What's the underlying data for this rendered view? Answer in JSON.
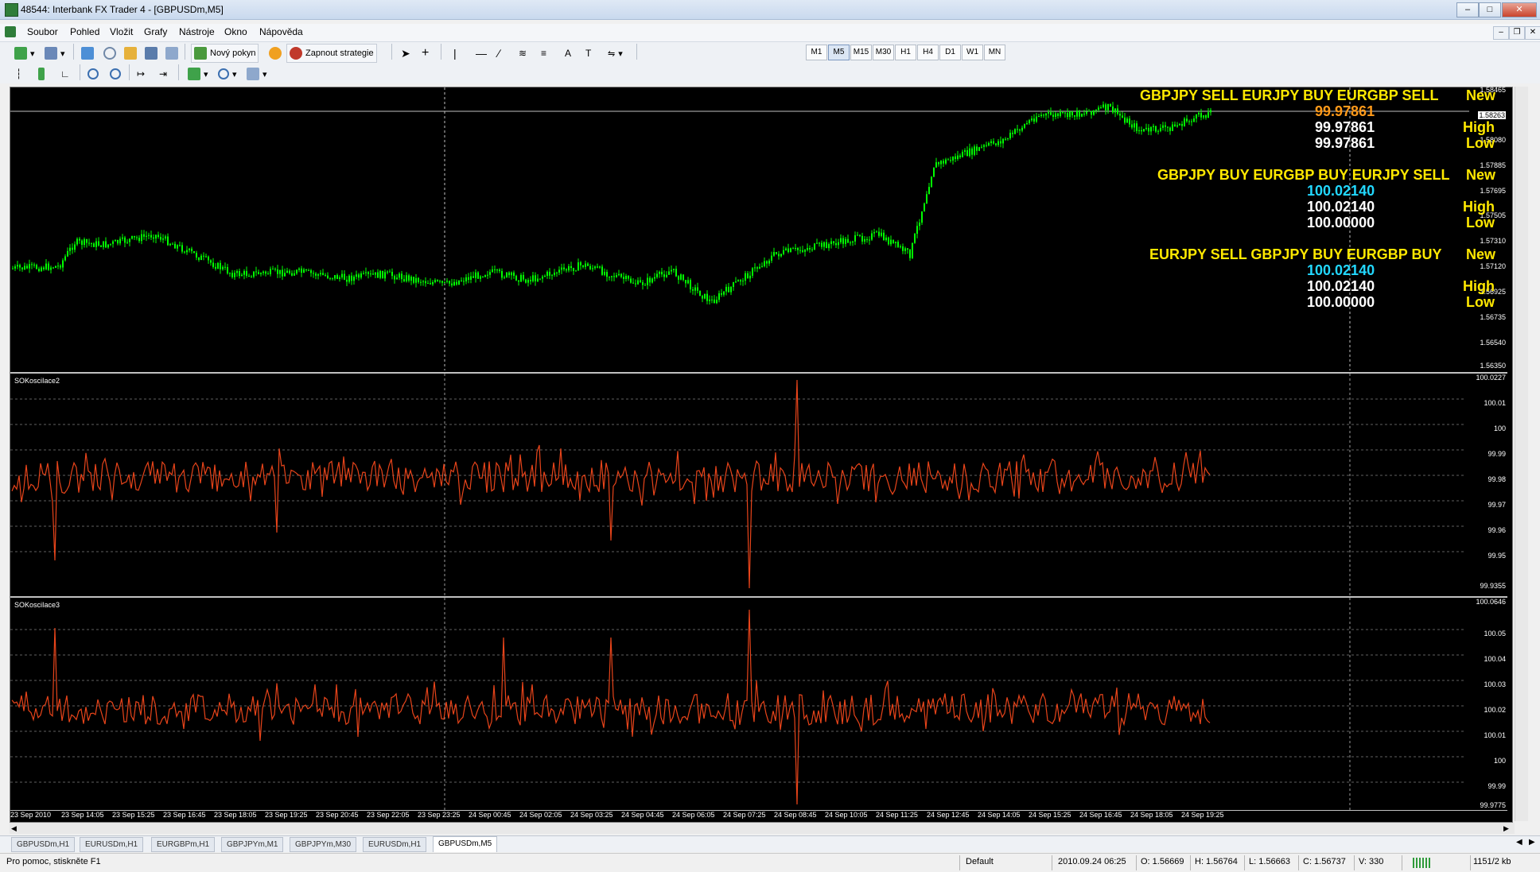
{
  "window": {
    "title": "48544: Interbank FX Trader 4 - [GBPUSDm,M5]"
  },
  "menu": [
    "Soubor",
    "Pohled",
    "Vložit",
    "Grafy",
    "Nástroje",
    "Okno",
    "Nápověda"
  ],
  "toolbar": {
    "new_order": "Nový pokyn",
    "strategies": "Zapnout strategie",
    "timeframes": [
      "M1",
      "M5",
      "M15",
      "M30",
      "H1",
      "H4",
      "D1",
      "W1",
      "MN"
    ],
    "active_timeframe": "M5",
    "text_tool": "A",
    "label_tool": "T"
  },
  "chart": {
    "price_scale": [
      "1.58465",
      "1.58263",
      "1.58080",
      "1.57885",
      "1.57695",
      "1.57505",
      "1.57310",
      "1.57120",
      "1.56925",
      "1.56735",
      "1.56540",
      "1.56350"
    ],
    "current_price": "1.58263",
    "signals": [
      {
        "pairs": "GBPJPY SELL  EURJPY BUY  EURGBP SELL",
        "status": "New",
        "value": "99.97861",
        "value_color": "orange",
        "high_value": "99.97861",
        "high_label": "High",
        "low_value": "99.97861",
        "low_label": "Low"
      },
      {
        "pairs": "GBPJPY BUY  EURGBP BUY  EURJPY SELL",
        "status": "New",
        "value": "100.02140",
        "value_color": "cyan",
        "high_value": "100.02140",
        "high_label": "High",
        "low_value": "100.00000",
        "low_label": "Low"
      },
      {
        "pairs": "EURJPY SELL  GBPJPY BUY  EURGBP BUY",
        "status": "New",
        "value": "100.02140",
        "value_color": "cyan",
        "high_value": "100.02140",
        "high_label": "High",
        "low_value": "100.00000",
        "low_label": "Low"
      }
    ],
    "indicator1": {
      "name": "SOKosciIace2",
      "scale": [
        "100.0227",
        "100.01",
        "100",
        "99.99",
        "99.98",
        "99.97",
        "99.96",
        "99.95",
        "99.9355"
      ]
    },
    "indicator2": {
      "name": "SOKosciIace3",
      "scale": [
        "100.0646",
        "100.05",
        "100.04",
        "100.03",
        "100.02",
        "100.01",
        "100",
        "99.99",
        "99.9775"
      ]
    },
    "x_labels": [
      "23 Sep 2010",
      "23 Sep 14:05",
      "23 Sep 15:25",
      "23 Sep 16:45",
      "23 Sep 18:05",
      "23 Sep 19:25",
      "23 Sep 20:45",
      "23 Sep 22:05",
      "23 Sep 23:25",
      "24 Sep 00:45",
      "24 Sep 02:05",
      "24 Sep 03:25",
      "24 Sep 04:45",
      "24 Sep 06:05",
      "24 Sep 07:25",
      "24 Sep 08:45",
      "24 Sep 10:05",
      "24 Sep 11:25",
      "24 Sep 12:45",
      "24 Sep 14:05",
      "24 Sep 15:25",
      "24 Sep 16:45",
      "24 Sep 18:05",
      "24 Sep 19:25"
    ],
    "colors": {
      "bull": "#00ff00",
      "indicator": "#e8441a",
      "signal_text": "#ffe800",
      "grid": "#c0c0c0"
    }
  },
  "tabs": [
    "GBPUSDm,H1",
    "EURUSDm,H1",
    "EURGBPm,H1",
    "GBPJPYm,M1",
    "GBPJPYm,M30",
    "EURUSDm,H1",
    "GBPUSDm,M5"
  ],
  "active_tab": "GBPUSDm,M5",
  "status": {
    "help": "Pro pomoc, stiskněte F1",
    "profile": "Default",
    "datetime": "2010.09.24 06:25",
    "open": "O: 1.56669",
    "high": "H: 1.56764",
    "low": "L: 1.56663",
    "close": "C: 1.56737",
    "volume": "V: 330",
    "traffic": "1151/2 kb"
  }
}
